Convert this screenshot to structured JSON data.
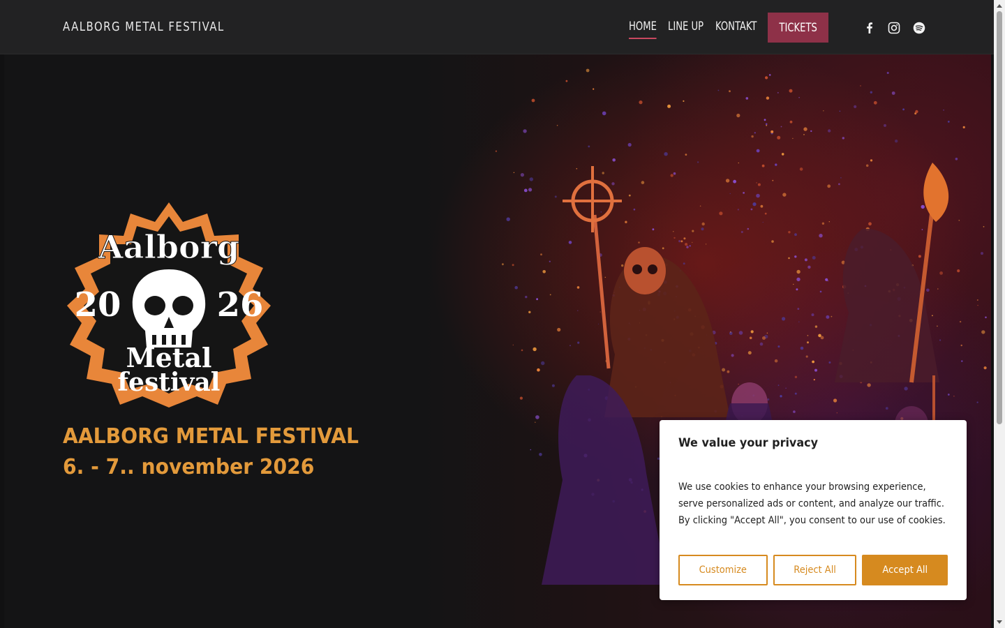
{
  "header": {
    "site_title": "AALBORG METAL FESTIVAL",
    "nav": [
      {
        "label": "HOME",
        "active": true
      },
      {
        "label": "LINE UP",
        "active": false
      },
      {
        "label": "KONTAKT",
        "active": false
      }
    ],
    "tickets_label": "TICKETS",
    "social_icons": [
      "facebook-icon",
      "instagram-icon",
      "spotify-icon"
    ]
  },
  "hero": {
    "logo_text": [
      "Aalborg",
      "20",
      "26",
      "Metal",
      "festival"
    ],
    "title": "AALBORG METAL FESTIVAL",
    "date": "6. - 7.. november 2026"
  },
  "cookie": {
    "title": "We value your privacy",
    "text": "We use cookies to enhance your browsing experience, serve personalized ads or content, and analyze our traffic. By clicking \"Accept All\", you consent to our use of cookies.",
    "customize_label": "Customize",
    "reject_label": "Reject All",
    "accept_label": "Accept All"
  },
  "colors": {
    "header_bg": "#222223",
    "accent_tickets": "#8e3148",
    "hero_text": "#e39a3b",
    "cookie_accent": "#d68a1f"
  }
}
